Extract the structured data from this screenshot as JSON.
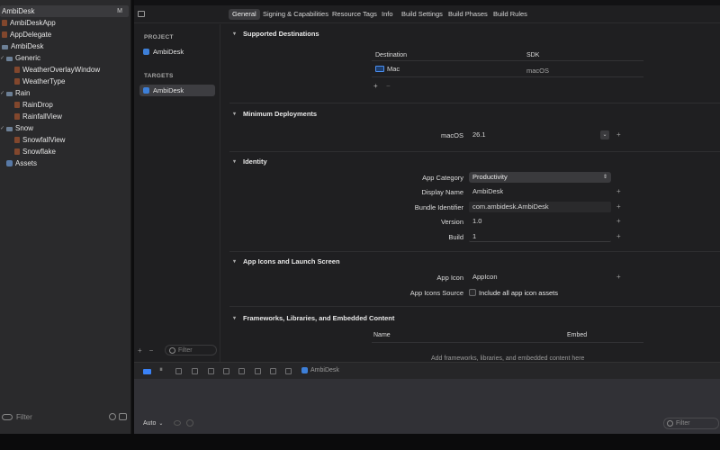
{
  "navigator": {
    "items": [
      {
        "label": "AmbiDesk",
        "badge": "M",
        "kind": "project",
        "selected": true
      },
      {
        "label": "AmbiDeskApp",
        "kind": "swift"
      },
      {
        "label": "AppDelegate",
        "kind": "swift"
      },
      {
        "label": "AmbiDesk",
        "kind": "folder"
      },
      {
        "label": "Generic",
        "kind": "folder",
        "expanded": true
      },
      {
        "label": "WeatherOverlayWindow",
        "kind": "swift"
      },
      {
        "label": "WeatherType",
        "kind": "swift"
      },
      {
        "label": "Rain",
        "kind": "folder",
        "expanded": true
      },
      {
        "label": "RainDrop",
        "kind": "swift"
      },
      {
        "label": "RainfallView",
        "kind": "swift"
      },
      {
        "label": "Snow",
        "kind": "folder",
        "expanded": true
      },
      {
        "label": "SnowfallView",
        "kind": "swift"
      },
      {
        "label": "Snowflake",
        "kind": "swift"
      },
      {
        "label": "Assets",
        "kind": "assets"
      }
    ],
    "filter_placeholder": "Filter"
  },
  "editor_tabs": [
    {
      "label": "General",
      "active": true
    },
    {
      "label": "Signing & Capabilities"
    },
    {
      "label": "Resource Tags"
    },
    {
      "label": "Info"
    },
    {
      "label": "Build Settings"
    },
    {
      "label": "Build Phases"
    },
    {
      "label": "Build Rules"
    }
  ],
  "targets_panel": {
    "project_heading": "PROJECT",
    "project_item": "AmbiDesk",
    "targets_heading": "TARGETS",
    "target_item": "AmbiDesk",
    "add_symbol": "+",
    "remove_symbol": "−",
    "filter_placeholder": "Filter"
  },
  "sections": {
    "supported_destinations": {
      "title": "Supported Destinations",
      "col_destination": "Destination",
      "col_sdk": "SDK",
      "row_destination": "Mac",
      "row_sdk": "macOS",
      "add_symbol": "+",
      "remove_symbol": "−"
    },
    "minimum_deployments": {
      "title": "Minimum Deployments",
      "label": "macOS",
      "value": "26.1"
    },
    "identity": {
      "title": "Identity",
      "app_category_label": "App Category",
      "app_category_value": "Productivity",
      "display_name_label": "Display Name",
      "display_name_value": "AmbiDesk",
      "bundle_identifier_label": "Bundle Identifier",
      "bundle_identifier_value": "com.ambidesk.AmbiDesk",
      "version_label": "Version",
      "version_value": "1.0",
      "build_label": "Build",
      "build_value": "1"
    },
    "app_icons": {
      "title": "App Icons and Launch Screen",
      "app_icon_label": "App Icon",
      "app_icon_value": "AppIcon",
      "app_icons_source_label": "App Icons Source",
      "include_all_label": "Include all app icon assets"
    },
    "frameworks": {
      "title": "Frameworks, Libraries, and Embedded Content",
      "col_name": "Name",
      "col_embed": "Embed",
      "empty_text": "Add frameworks, libraries, and embedded content here"
    }
  },
  "debug_bar": {
    "scheme_label": "AmbiDesk"
  },
  "console": {
    "mode_label": "Auto",
    "filter_placeholder": "Filter"
  },
  "plus_symbol": "+"
}
